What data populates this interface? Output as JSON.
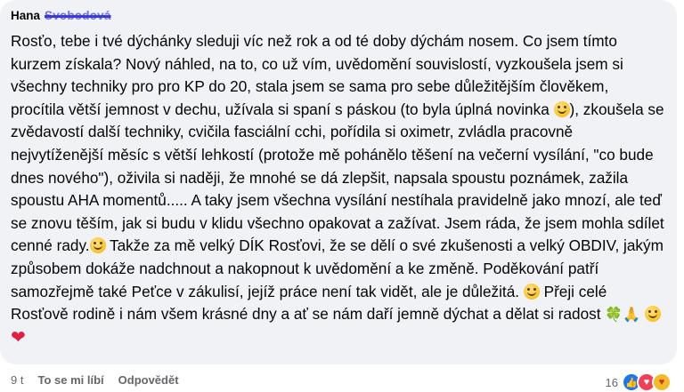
{
  "comment": {
    "author_first": "Hana",
    "author_last_redacted": "Svobodová",
    "text_part1": "Rosťo, tebe i tvé dýchánky sleduji víc než rok a od té doby dýchám nosem. Co jsem tímto kurzem získala? Nový náhled, na to, co už vím, uvědomění souvislostí, vyzkoušela jsem si všechny techniky pro pro KP do 20, stala jsem se sama pro sebe důležitějším člověkem, procítila větší jemnost v dechu, užívala si spaní s páskou (to byla úplná novinka ",
    "text_part2": "), zkoušela se zvědavostí další techniky, cvičila fasciální cchi, pořídila si oximetr, zvládla pracovně nejvytíženější měsíc s větší lehkostí (protože mě pohánělo těšení na večerní vysílání, \"co bude dnes nového\"), oživila si naději, že mnohé se dá zlepšit, napsala spoustu poznámek, zažila spoustu AHA momentů..... A taky jsem všechna vysílání nestíhala pravidelně jako mnozí, ale teď se znovu těším, jak si budu v klidu všechno opakovat a zažívat. Jsem ráda, že jsem mohla sdílet cenné rady.",
    "text_part3": " Takže za mě velký DÍK Rosťovi, že se dělí o své zkušenosti a velký OBDIV, jakým způsobem dokáže nadchnout a nakopnout k uvědomění a ke změně. Poděkování patří samozřejmě také Peťce v zákulisí, jejíž práce není tak vidět, ale je důležitá. ",
    "text_part4": " Přeji celé Rosťově rodině i nám všem krásné dny a ať se nám daří jemně dýchat a dělat si radost ",
    "heart": "❤",
    "clover": "🍀",
    "pray": "🙏"
  },
  "actions": {
    "time": "9 t",
    "like_label": "To se mi líbí",
    "reply_label": "Odpovědět"
  },
  "reactions": {
    "count": "16",
    "types": [
      "like-icon",
      "love-icon",
      "care-icon"
    ],
    "like_symbol": "👍",
    "love_symbol": "♥",
    "care_symbol": "♥"
  },
  "colors": {
    "bubble_bg": "#f0f2f5",
    "like_blue": "#1877f2",
    "love_red": "#f33e58",
    "care_yellow": "#f7b928"
  }
}
